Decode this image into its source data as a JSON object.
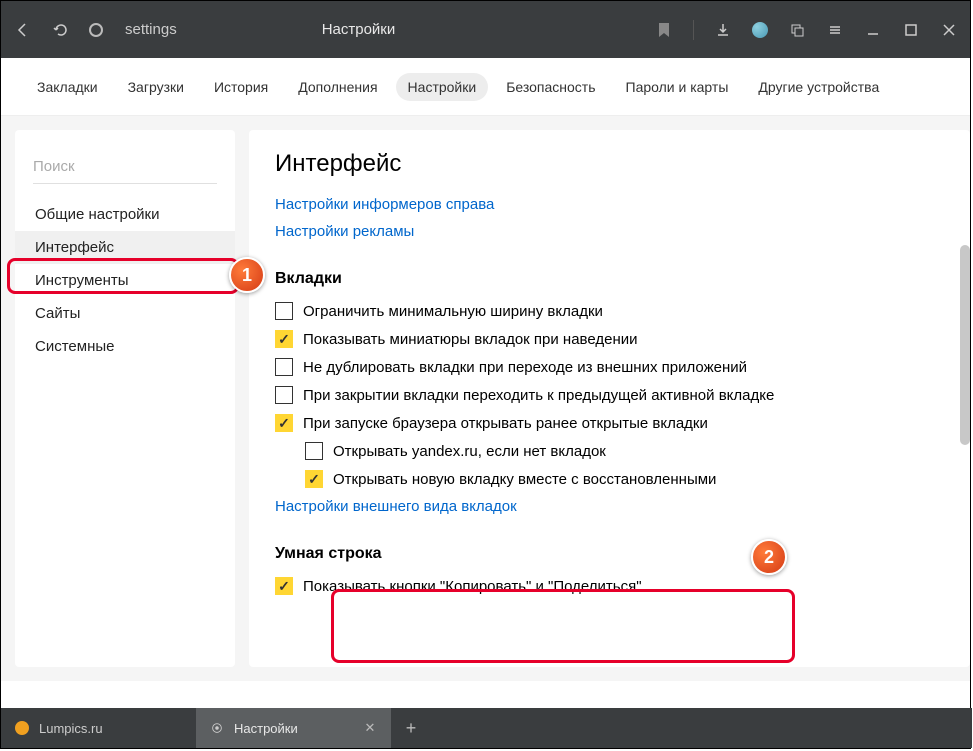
{
  "titlebar": {
    "url_text": "settings",
    "page_title": "Настройки"
  },
  "topnav": {
    "items": [
      "Закладки",
      "Загрузки",
      "История",
      "Дополнения",
      "Настройки",
      "Безопасность",
      "Пароли и карты",
      "Другие устройства"
    ],
    "active_index": 4
  },
  "sidebar": {
    "search_placeholder": "Поиск",
    "items": [
      "Общие настройки",
      "Интерфейс",
      "Инструменты",
      "Сайты",
      "Системные"
    ],
    "selected_index": 1
  },
  "callouts": {
    "c1": "1",
    "c2": "2"
  },
  "content": {
    "heading": "Интерфейс",
    "link1": "Настройки информеров справа",
    "link2": "Настройки рекламы",
    "section_tabs": "Вкладки",
    "cb1": {
      "label": "Ограничить минимальную ширину вкладки",
      "checked": false
    },
    "cb2": {
      "label": "Показывать миниатюры вкладок при наведении",
      "checked": true
    },
    "cb3": {
      "label": "Не дублировать вкладки при переходе из внешних приложений",
      "checked": false
    },
    "cb4": {
      "label": "При закрытии вкладки переходить к предыдущей активной вкладке",
      "checked": false
    },
    "cb5": {
      "label": "При запуске браузера открывать ранее открытые вкладки",
      "checked": true
    },
    "cb5a": {
      "label": "Открывать yandex.ru, если нет вкладок",
      "checked": false
    },
    "cb5b": {
      "label": "Открывать новую вкладку вместе с восстановленными",
      "checked": true
    },
    "link3": "Настройки внешнего вида вкладок",
    "section_smart": "Умная строка",
    "cb6": {
      "label": "Показывать кнопки \"Копировать\" и \"Поделиться\"",
      "checked": true
    }
  },
  "tabbar": {
    "tab1": "Lumpics.ru",
    "tab2": "Настройки"
  }
}
